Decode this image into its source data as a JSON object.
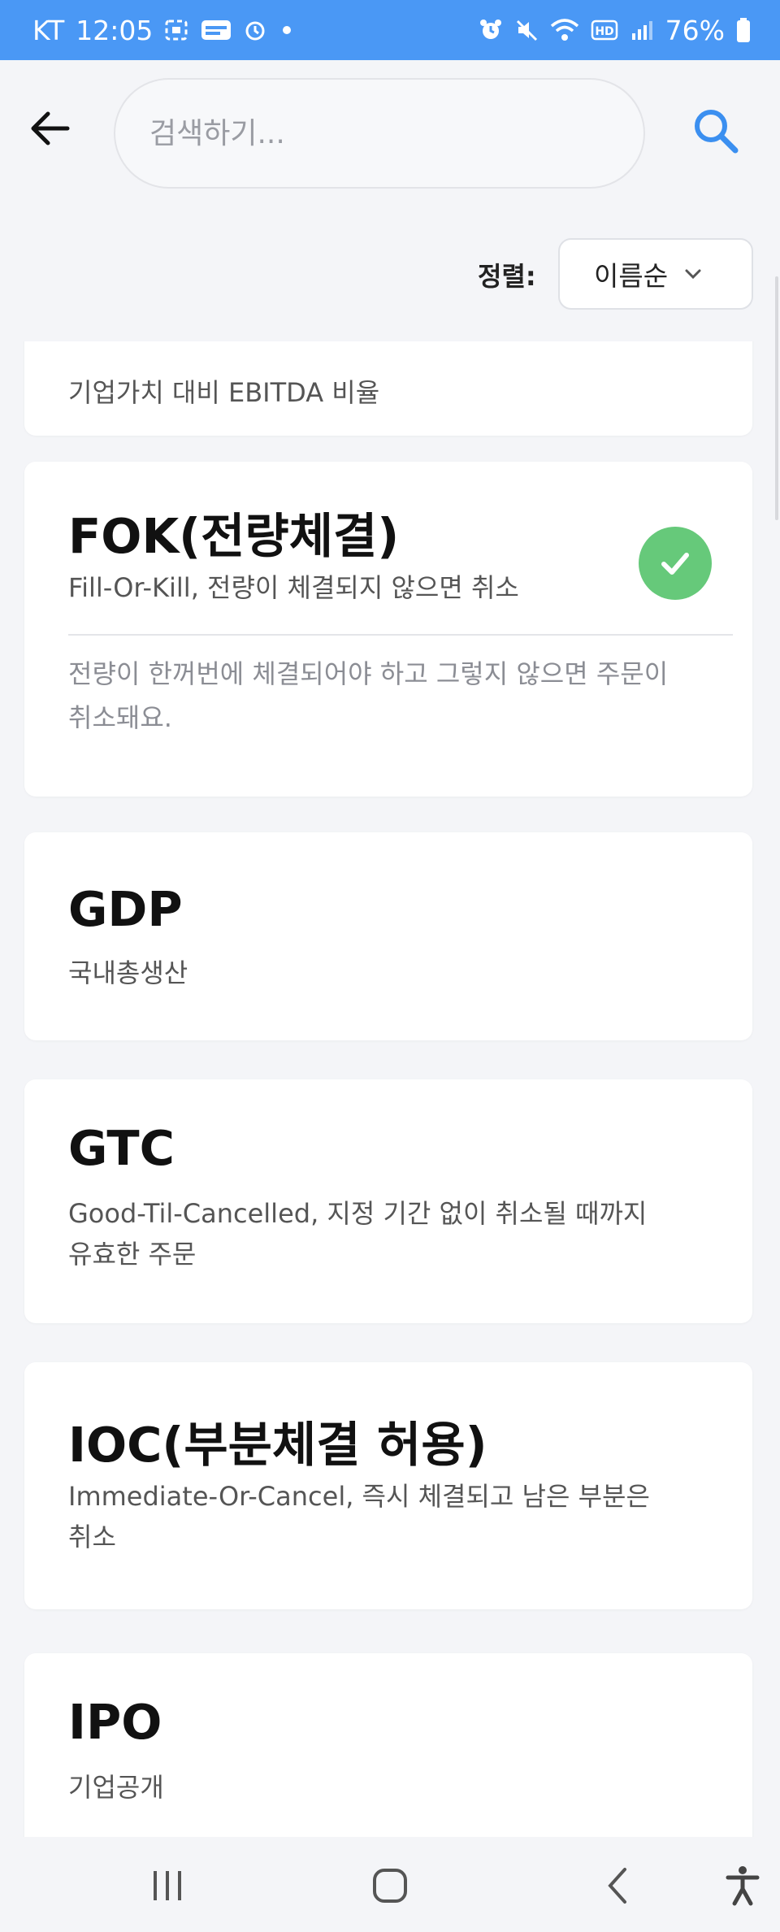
{
  "status_bar": {
    "carrier": "KT",
    "time": "12:05",
    "battery": "76%"
  },
  "header": {
    "search_placeholder": "검색하기...",
    "back_icon": "arrow-left-icon",
    "search_icon": "search-icon"
  },
  "sort": {
    "label": "정렬:",
    "selected": "이름순"
  },
  "terms": [
    {
      "desc": "기업가치 대비 EBITDA 비율"
    },
    {
      "term": "FOK(전량체결)",
      "desc": "Fill-Or-Kill, 전량이 체결되지 않으면 취소",
      "detail": "전량이 한꺼번에 체결되어야 하고 그렇지 않으면 주문이 취소돼요.",
      "selected": true
    },
    {
      "term": "GDP",
      "desc": "국내총생산"
    },
    {
      "term": "GTC",
      "desc": "Good-Til-Cancelled, 지정 기간 없이 취소될 때까지 유효한 주문"
    },
    {
      "term": "IOC(부분체결 허용)",
      "desc": "Immediate-Or-Cancel, 즉시 체결되고 남은 부분은 취소"
    },
    {
      "term": "IPO",
      "desc": "기업공개"
    }
  ],
  "colors": {
    "status_bar": "#4a98f5",
    "accent_blue": "#3b8ff0",
    "check_green": "#66c97a"
  }
}
